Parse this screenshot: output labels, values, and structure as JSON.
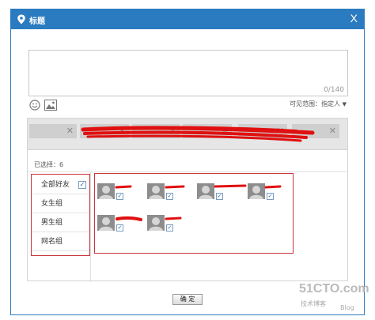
{
  "dialog": {
    "title": "标题",
    "close_label": "X",
    "accent_color": "#2b7bc0"
  },
  "compose": {
    "value": "",
    "counter": "0/140"
  },
  "toolbar": {
    "emoji_icon": "smile-icon",
    "image_icon": "image-icon",
    "visibility_label": "可见范围：",
    "visibility_value": "指定人",
    "visibility_caret": "▼"
  },
  "tags": [
    {
      "label": "",
      "close": "✕"
    },
    {
      "label": "",
      "close": "✕"
    },
    {
      "label": "",
      "close": "✕"
    },
    {
      "label": "",
      "close": "✕"
    },
    {
      "label": "",
      "close": "✕"
    },
    {
      "label": "",
      "close": "✕"
    }
  ],
  "selected_label": "已选择：6",
  "groups": [
    {
      "label": "全部好友",
      "checked": true,
      "check": "✓"
    },
    {
      "label": "女生组"
    },
    {
      "label": "男生组"
    },
    {
      "label": "网名组"
    }
  ],
  "friends": [
    {
      "name": "",
      "check": "✓"
    },
    {
      "name": "",
      "check": "✓"
    },
    {
      "name": "",
      "check": "✓"
    },
    {
      "name": "",
      "check": "✓"
    },
    {
      "name": "",
      "check": "✓"
    },
    {
      "name": "",
      "check": "✓"
    }
  ],
  "ok_label": "确 定",
  "watermark": {
    "line1": "51CTO.com",
    "line2": "技术博客",
    "line3": "Blog"
  },
  "annotation_color": "#c9343a"
}
